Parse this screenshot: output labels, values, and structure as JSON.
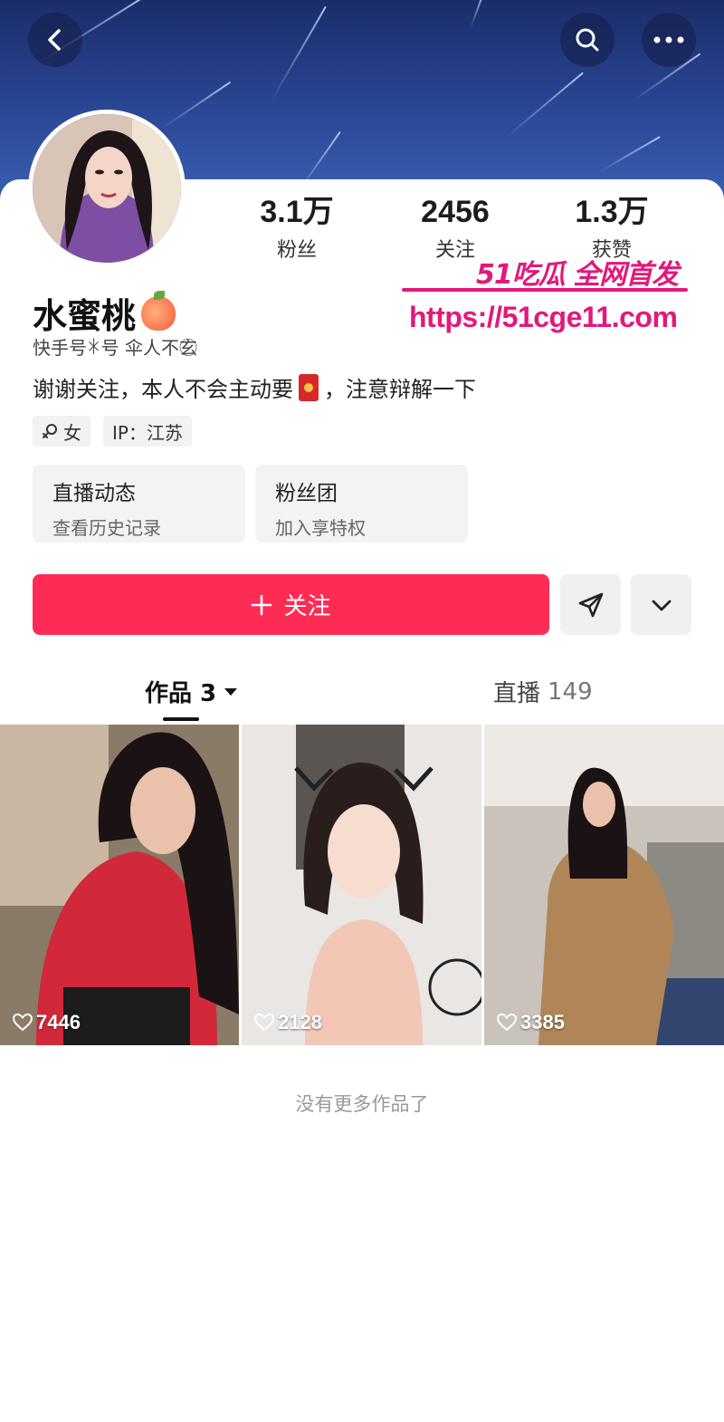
{
  "profile": {
    "name": "水蜜桃",
    "kuaishou_id": "快手号ꁘ号  伞人不玄⃝",
    "bio_before": "谢谢关注，本人不会主动要",
    "bio_after": "，注意辩解一下",
    "gender_tag": "女",
    "ip_tag": "IP：江苏"
  },
  "stats": [
    {
      "value": "3.1万",
      "label": "粉丝"
    },
    {
      "value": "2456",
      "label": "关注"
    },
    {
      "value": "1.3万",
      "label": "获赞"
    }
  ],
  "features": [
    {
      "title": "直播动态",
      "subtitle": "查看历史记录"
    },
    {
      "title": "粉丝团",
      "subtitle": "加入享特权"
    }
  ],
  "actions": {
    "follow_label": "关注"
  },
  "tabs": [
    {
      "label": "作品 3"
    },
    {
      "label": "直播",
      "count": "149"
    }
  ],
  "works": [
    {
      "likes": "7446"
    },
    {
      "likes": "2128"
    },
    {
      "likes": "3385"
    }
  ],
  "footer": {
    "no_more": "没有更多作品了"
  },
  "watermark": {
    "title": "51吃瓜 全网首发",
    "url": "https://51cge11.com"
  },
  "colors": {
    "accent": "#fe2c55",
    "watermark": "#e2197a"
  }
}
